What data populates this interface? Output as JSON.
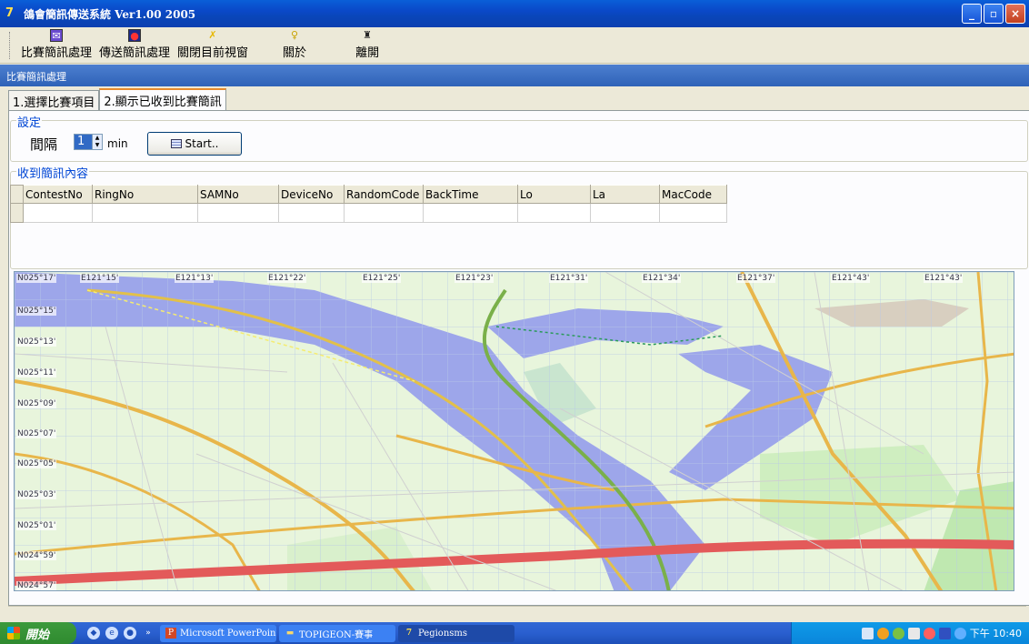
{
  "window": {
    "title": "鴿會簡訊傳送系統 Ver1.00 2005",
    "controls": [
      "_",
      "▫",
      "×"
    ]
  },
  "toolbar": {
    "buttons": [
      {
        "label": "比賽簡訊處理",
        "icon": "message-icon"
      },
      {
        "label": "傳送簡訊處理",
        "icon": "send-icon"
      },
      {
        "label": "關閉目前視窗",
        "icon": "close-window-icon"
      },
      {
        "label": "關於",
        "icon": "about-icon"
      },
      {
        "label": "離開",
        "icon": "exit-icon"
      }
    ]
  },
  "section": {
    "title": "比賽簡訊處理"
  },
  "tabs": [
    {
      "label": "1.選擇比賽項目",
      "active": false
    },
    {
      "label": "2.顯示已收到比賽簡訊",
      "active": true
    }
  ],
  "settings": {
    "legend": "設定",
    "interval_label": "間隔",
    "interval_value": "1",
    "unit": "min",
    "start_label": "Start.."
  },
  "received": {
    "legend": "收到簡訊內容",
    "columns": [
      "ContestNo",
      "RingNo",
      "SAMNo",
      "DeviceNo",
      "RandomCode",
      "BackTime",
      "Lo",
      "La",
      "MacCode"
    ]
  },
  "map": {
    "top_labels": [
      "N025°17'",
      "E121°15'",
      "E121°13'",
      "E121°22'",
      "E121°25'",
      "E121°23'",
      "E121°31'",
      "E121°34'",
      "E121°37'",
      "E121°43'",
      "E121°43'"
    ],
    "left_labels": [
      "N025°15'",
      "N025°13'",
      "N025°11'",
      "N025°09'",
      "N025°07'",
      "N025°05'",
      "N025°03'",
      "N025°01'",
      "N024°59'",
      "N024°57'"
    ]
  },
  "taskbar": {
    "start_label": "開始",
    "tasks": [
      {
        "label": "Microsoft PowerPoint ...",
        "active": false
      },
      {
        "label": "TOPIGEON-賽事",
        "active": false
      },
      {
        "label": "Pegionsms",
        "active": true
      }
    ],
    "clock": "下午 10:40"
  },
  "colors": {
    "titlebar": "#0a4fd0",
    "section_header": "#3a6cc0",
    "river": "#9da6ea",
    "land": "#e8f5dc",
    "highway": "#e35a5a",
    "main_road": "#f0c060"
  }
}
